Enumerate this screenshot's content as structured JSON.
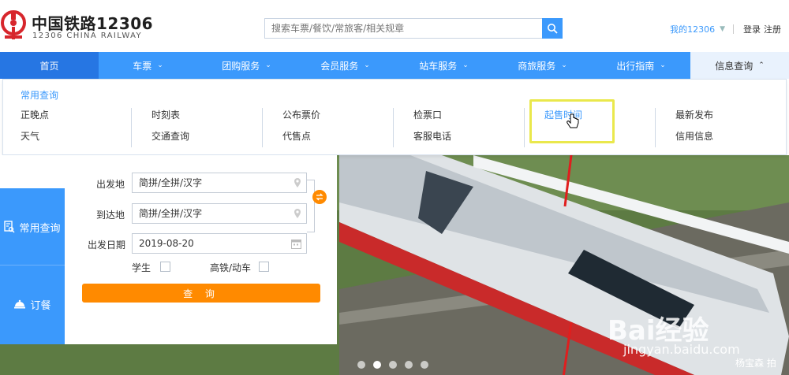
{
  "header": {
    "brand_cn": "中国铁路12306",
    "brand_en": "12306 CHINA RAILWAY",
    "search_placeholder": "搜索车票/餐饮/常旅客/相关规章",
    "my12306": "我的12306",
    "login": "登录",
    "register": "注册"
  },
  "nav": {
    "items": [
      {
        "label": "首页",
        "has_chevron": false
      },
      {
        "label": "车票",
        "chevron": "⌄"
      },
      {
        "label": "团购服务",
        "chevron": "⌄"
      },
      {
        "label": "会员服务",
        "chevron": "⌄"
      },
      {
        "label": "站车服务",
        "chevron": "⌄"
      },
      {
        "label": "商旅服务",
        "chevron": "⌄"
      },
      {
        "label": "出行指南",
        "chevron": "⌄"
      },
      {
        "label": "信息查询",
        "chevron": "⌃"
      }
    ]
  },
  "dropdown": {
    "title": "常用查询",
    "columns": [
      [
        "正晚点",
        "天气"
      ],
      [
        "时刻表",
        "交通查询"
      ],
      [
        "公布票价",
        "代售点"
      ],
      [
        "检票口",
        "客服电话"
      ],
      [
        "起售时间"
      ],
      [
        "最新发布",
        "信用信息"
      ]
    ]
  },
  "booking": {
    "tabs": [
      {
        "label": "常用查询",
        "icon": "document-search-icon"
      },
      {
        "label": "订餐",
        "icon": "food-cloche-icon"
      }
    ],
    "from_label": "出发地",
    "from_placeholder": "简拼/全拼/汉字",
    "to_label": "到达地",
    "to_placeholder": "简拼/全拼/汉字",
    "date_label": "出发日期",
    "date_value": "2019-08-20",
    "student_label": "学生",
    "highspeed_label": "高铁/动车",
    "search_label": "查 询"
  },
  "carousel": {
    "count": 5,
    "active": 1
  },
  "watermark": {
    "brand": "Bai经验",
    "url": "jingyan.baidu.com",
    "credit": "杨宝森 拍"
  },
  "colors": {
    "primary": "#3b99fc",
    "nav_dark": "#2676e3",
    "accent": "#ff8a00",
    "highlight": "#eae84c",
    "annotation_arrow": "#e01e1e",
    "logo_red": "#d7262c"
  }
}
